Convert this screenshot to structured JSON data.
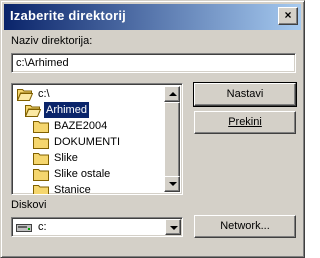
{
  "window": {
    "title": "Izaberite direktorij",
    "close_label": "×"
  },
  "dir_name": {
    "label": "Naziv direktorija:",
    "value": "c:\\Arhimed"
  },
  "tree": [
    {
      "label": "c:\\",
      "icon": "folder-open-icon",
      "indent": 0,
      "selected": false
    },
    {
      "label": "Arhimed",
      "icon": "folder-open-icon",
      "indent": 1,
      "selected": true
    },
    {
      "label": "BAZE2004",
      "icon": "folder-icon",
      "indent": 2,
      "selected": false
    },
    {
      "label": "DOKUMENTI",
      "icon": "folder-icon",
      "indent": 2,
      "selected": false
    },
    {
      "label": "Slike",
      "icon": "folder-icon",
      "indent": 2,
      "selected": false
    },
    {
      "label": "Slike ostale",
      "icon": "folder-icon",
      "indent": 2,
      "selected": false
    },
    {
      "label": "Stanice",
      "icon": "folder-icon",
      "indent": 2,
      "selected": false
    }
  ],
  "buttons": {
    "ok": "Nastavi",
    "cancel": "Prekini",
    "network": "Network..."
  },
  "drives": {
    "label": "Diskovi",
    "value": "c:"
  },
  "colors": {
    "title_start": "#0a246a",
    "title_end": "#a6caf0",
    "selection": "#0a246a",
    "folder": "#f5d66e"
  }
}
